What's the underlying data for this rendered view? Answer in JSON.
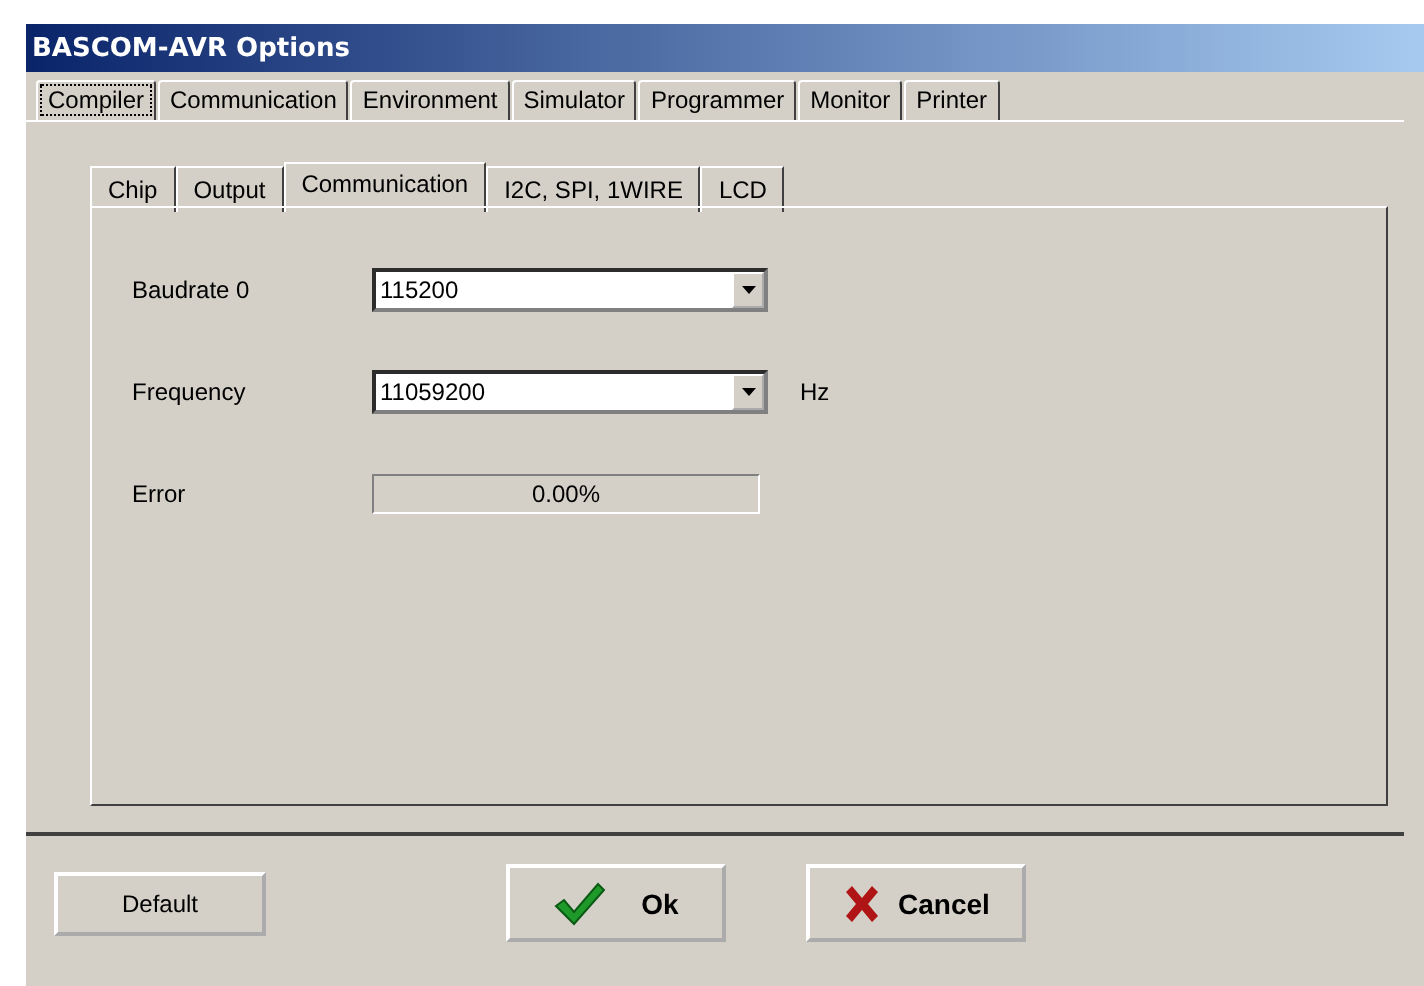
{
  "window": {
    "title": "BASCOM-AVR Options"
  },
  "tabs": [
    {
      "label": "Compiler",
      "selected": true
    },
    {
      "label": "Communication",
      "selected": false
    },
    {
      "label": "Environment",
      "selected": false
    },
    {
      "label": "Simulator",
      "selected": false
    },
    {
      "label": "Programmer",
      "selected": false
    },
    {
      "label": "Monitor",
      "selected": false
    },
    {
      "label": "Printer",
      "selected": false
    }
  ],
  "subtabs": [
    {
      "label": "Chip",
      "selected": false
    },
    {
      "label": "Output",
      "selected": false
    },
    {
      "label": "Communication",
      "selected": true
    },
    {
      "label": "I2C, SPI, 1WIRE",
      "selected": false
    },
    {
      "label": "LCD",
      "selected": false
    }
  ],
  "fields": [
    {
      "kind": "combo",
      "label": "Baudrate 0",
      "value": "115200"
    },
    {
      "kind": "combo",
      "label": "Frequency",
      "value": "11059200",
      "unit": "Hz"
    },
    {
      "kind": "readout",
      "label": "Error",
      "value": "0.00%"
    }
  ],
  "buttons": [
    {
      "kind": "plain",
      "label": "Default"
    },
    {
      "kind": "ok",
      "label": "Ok"
    },
    {
      "kind": "cancel",
      "label": "Cancel"
    }
  ]
}
